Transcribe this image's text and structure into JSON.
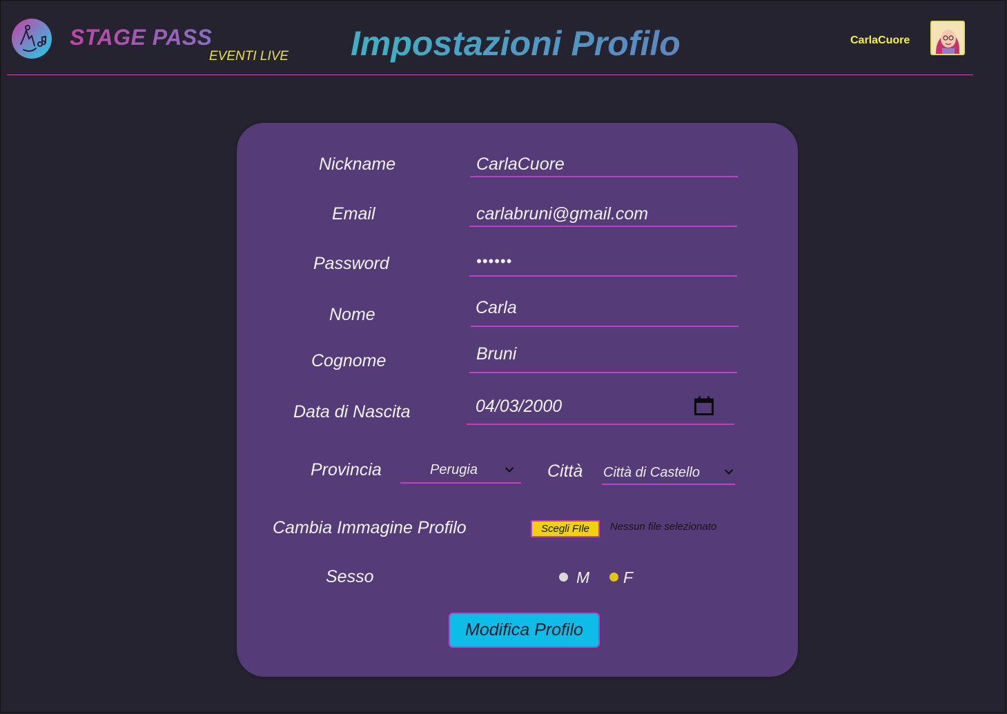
{
  "header": {
    "brand_name": "STAGE PASS",
    "brand_tagline": "EVENTI LIVE",
    "page_title": "Impostazioni Profilo",
    "username": "CarlaCuore",
    "logo_icon": "music-hand-icon",
    "avatar_icon": "avatar-image"
  },
  "form": {
    "nickname": {
      "label": "Nickname",
      "value": "CarlaCuore"
    },
    "email": {
      "label": "Email",
      "value": "carlabruni@gmail.com"
    },
    "password": {
      "label": "Password",
      "value": "••••••"
    },
    "nome": {
      "label": "Nome",
      "value": "Carla"
    },
    "cognome": {
      "label": "Cognome",
      "value": "Bruni"
    },
    "data_nascita": {
      "label": "Data di Nascita",
      "value": "04/03/2000",
      "icon": "calendar-icon"
    },
    "provincia": {
      "label": "Provincia",
      "selected": "Perugia"
    },
    "citta": {
      "label": "Città",
      "selected": "Città di Castello"
    },
    "immagine": {
      "label": "Cambia Immagine Profilo",
      "button": "Scegli FIle",
      "status": "Nessun file selezionato"
    },
    "sesso": {
      "label": "Sesso",
      "options": [
        "M",
        "F"
      ],
      "selected": "F"
    },
    "submit": "Modifica Profilo"
  },
  "colors": {
    "background": "#24232f",
    "card": "#553b78",
    "underline": "#c040c8",
    "accent_yellow": "#f2d10c",
    "button_cyan": "#0dbde8",
    "title_gradient_start": "#3fb1c4",
    "brand_pink": "#c044a8"
  }
}
